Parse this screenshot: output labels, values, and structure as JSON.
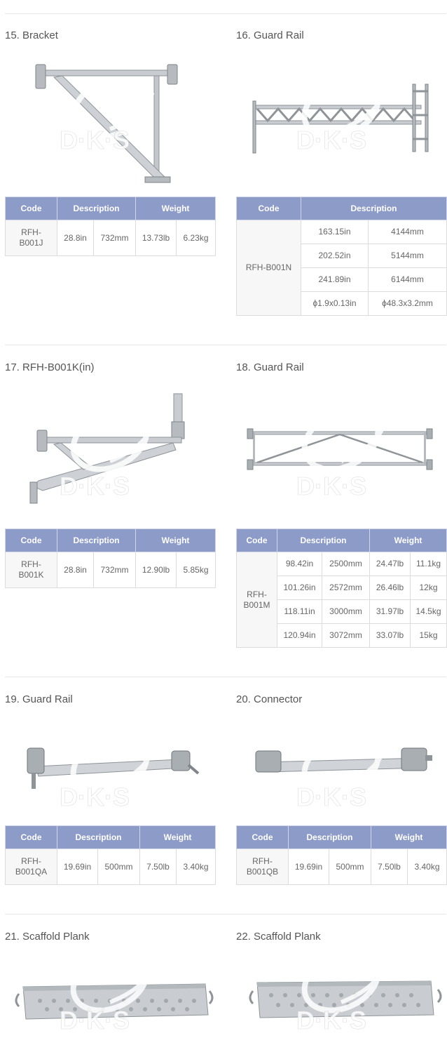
{
  "watermark": {
    "text": "D·K·S"
  },
  "items": {
    "b15": {
      "title": "15. Bracket",
      "headers": {
        "code": "Code",
        "description": "Description",
        "weight": "Weight"
      },
      "code_lines": [
        "RFH-",
        "B001J"
      ],
      "desc": [
        "28.8in",
        "732mm"
      ],
      "weight": [
        "13.73lb",
        "6.23kg"
      ]
    },
    "b16": {
      "title": "16. Guard Rail",
      "headers": {
        "code": "Code",
        "description": "Description"
      },
      "code": "RFH-B001N",
      "rows": [
        [
          "163.15in",
          "4144mm"
        ],
        [
          "202.52in",
          "5144mm"
        ],
        [
          "241.89in",
          "6144mm"
        ],
        [
          "ϕ1.9x0.13in",
          "ϕ48.3x3.2mm"
        ]
      ]
    },
    "b17": {
      "title": "17. RFH-B001K(in)",
      "headers": {
        "code": "Code",
        "description": "Description",
        "weight": "Weight"
      },
      "code_lines": [
        "RFH-",
        "B001K"
      ],
      "desc": [
        "28.8in",
        "732mm"
      ],
      "weight": [
        "12.90lb",
        "5.85kg"
      ]
    },
    "b18": {
      "title": "18. Guard Rail",
      "headers": {
        "code": "Code",
        "description": "Description",
        "weight": "Weight"
      },
      "code_lines": [
        "RFH-",
        "B001M"
      ],
      "rows": [
        [
          "98.42in",
          "2500mm",
          "24.47lb",
          "11.1kg"
        ],
        [
          "101.26in",
          "2572mm",
          "26.46lb",
          "12kg"
        ],
        [
          "118.11in",
          "3000mm",
          "31.97lb",
          "14.5kg"
        ],
        [
          "120.94in",
          "3072mm",
          "33.07lb",
          "15kg"
        ]
      ]
    },
    "b19": {
      "title": "19. Guard Rail",
      "headers": {
        "code": "Code",
        "description": "Description",
        "weight": "Weight"
      },
      "code_lines": [
        "RFH-",
        "B001QA"
      ],
      "desc": [
        "19.69in",
        "500mm"
      ],
      "weight": [
        "7.50lb",
        "3.40kg"
      ]
    },
    "b20": {
      "title": "20. Connector",
      "headers": {
        "code": "Code",
        "description": "Description",
        "weight": "Weight"
      },
      "code_lines": [
        "RFH-",
        "B001QB"
      ],
      "desc": [
        "19.69in",
        "500mm"
      ],
      "weight": [
        "7.50lb",
        "3.40kg"
      ]
    },
    "b21": {
      "title": "21. Scaffold Plank"
    },
    "b22": {
      "title": "22. Scaffold Plank"
    }
  },
  "colors": {
    "header_bg": "#8d9bc9",
    "border": "#dcdcdc",
    "metal": "#c9ccd0",
    "metal_dark": "#8f9499"
  },
  "icons": [
    "bracket-image",
    "guard-rail-image",
    "connector-image",
    "scaffold-plank-image",
    "dks-watermark-logo"
  ]
}
